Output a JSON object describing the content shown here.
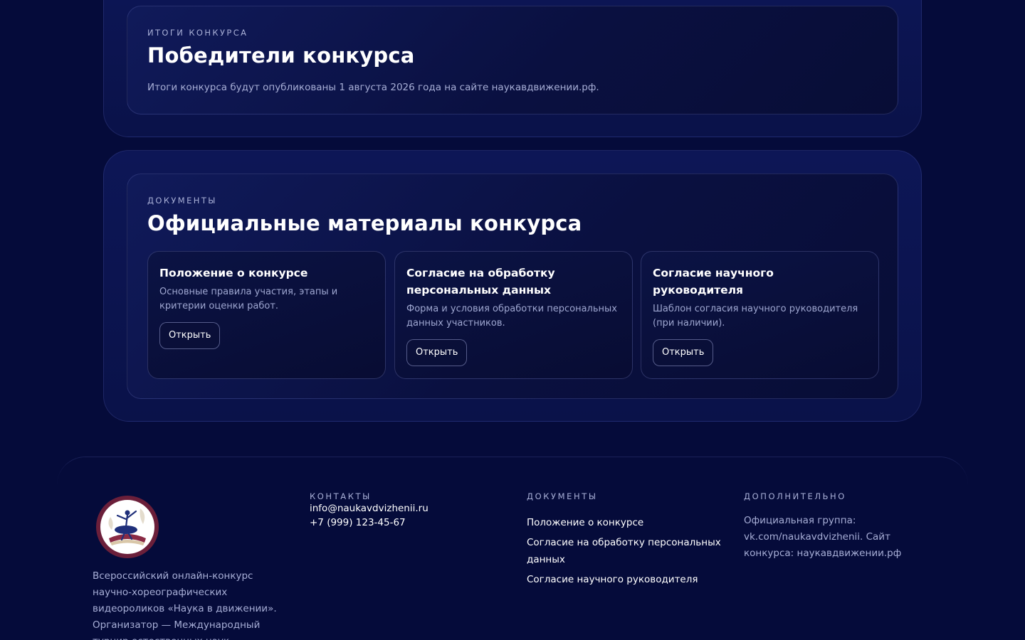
{
  "results": {
    "eyebrow": "ИТОГИ КОНКУРСА",
    "title": "Победители конкурса",
    "description": "Итоги конкурса будут опубликованы 1 августа 2026 года на сайте наукавдвижении.рф."
  },
  "documents": {
    "eyebrow": "ДОКУМЕНТЫ",
    "title": "Официальные материалы конкурса",
    "cards": [
      {
        "title": "Положение о конкурсе",
        "description": "Основные правила участия, этапы и критерии оценки работ.",
        "button": "Открыть"
      },
      {
        "title": "Согласие на обработку персональных данных",
        "description": "Форма и условия обработки персональных данных участников.",
        "button": "Открыть"
      },
      {
        "title": "Согласие научного руководителя",
        "description": "Шаблон согласия научного руководителя (при наличии).",
        "button": "Открыть"
      }
    ]
  },
  "footer": {
    "about": "Всероссийский онлайн-конкурс научно-хореографических видеороликов «Наука в движении». Организатор — Международный турнир естественных наук",
    "contacts": {
      "heading": "КОНТАКТЫ",
      "email": "info@naukavdvizhenii.ru",
      "phone": "+7 (999) 123-45-67"
    },
    "docs": {
      "heading": "ДОКУМЕНТЫ",
      "links": [
        "Положение о конкурсе",
        "Согласие на обработку персональных данных",
        "Согласие научного руководителя"
      ]
    },
    "extra": {
      "heading": "ДОПОЛНИТЕЛЬНО",
      "text": "Официальная группа: vk.com/naukavdvizhenii. Сайт конкурса: наукавдвижении.рф"
    }
  },
  "colors": {
    "background": "#050b3a",
    "logo_ring": "#6b1f3a",
    "muted_text": "#a7aed6"
  }
}
